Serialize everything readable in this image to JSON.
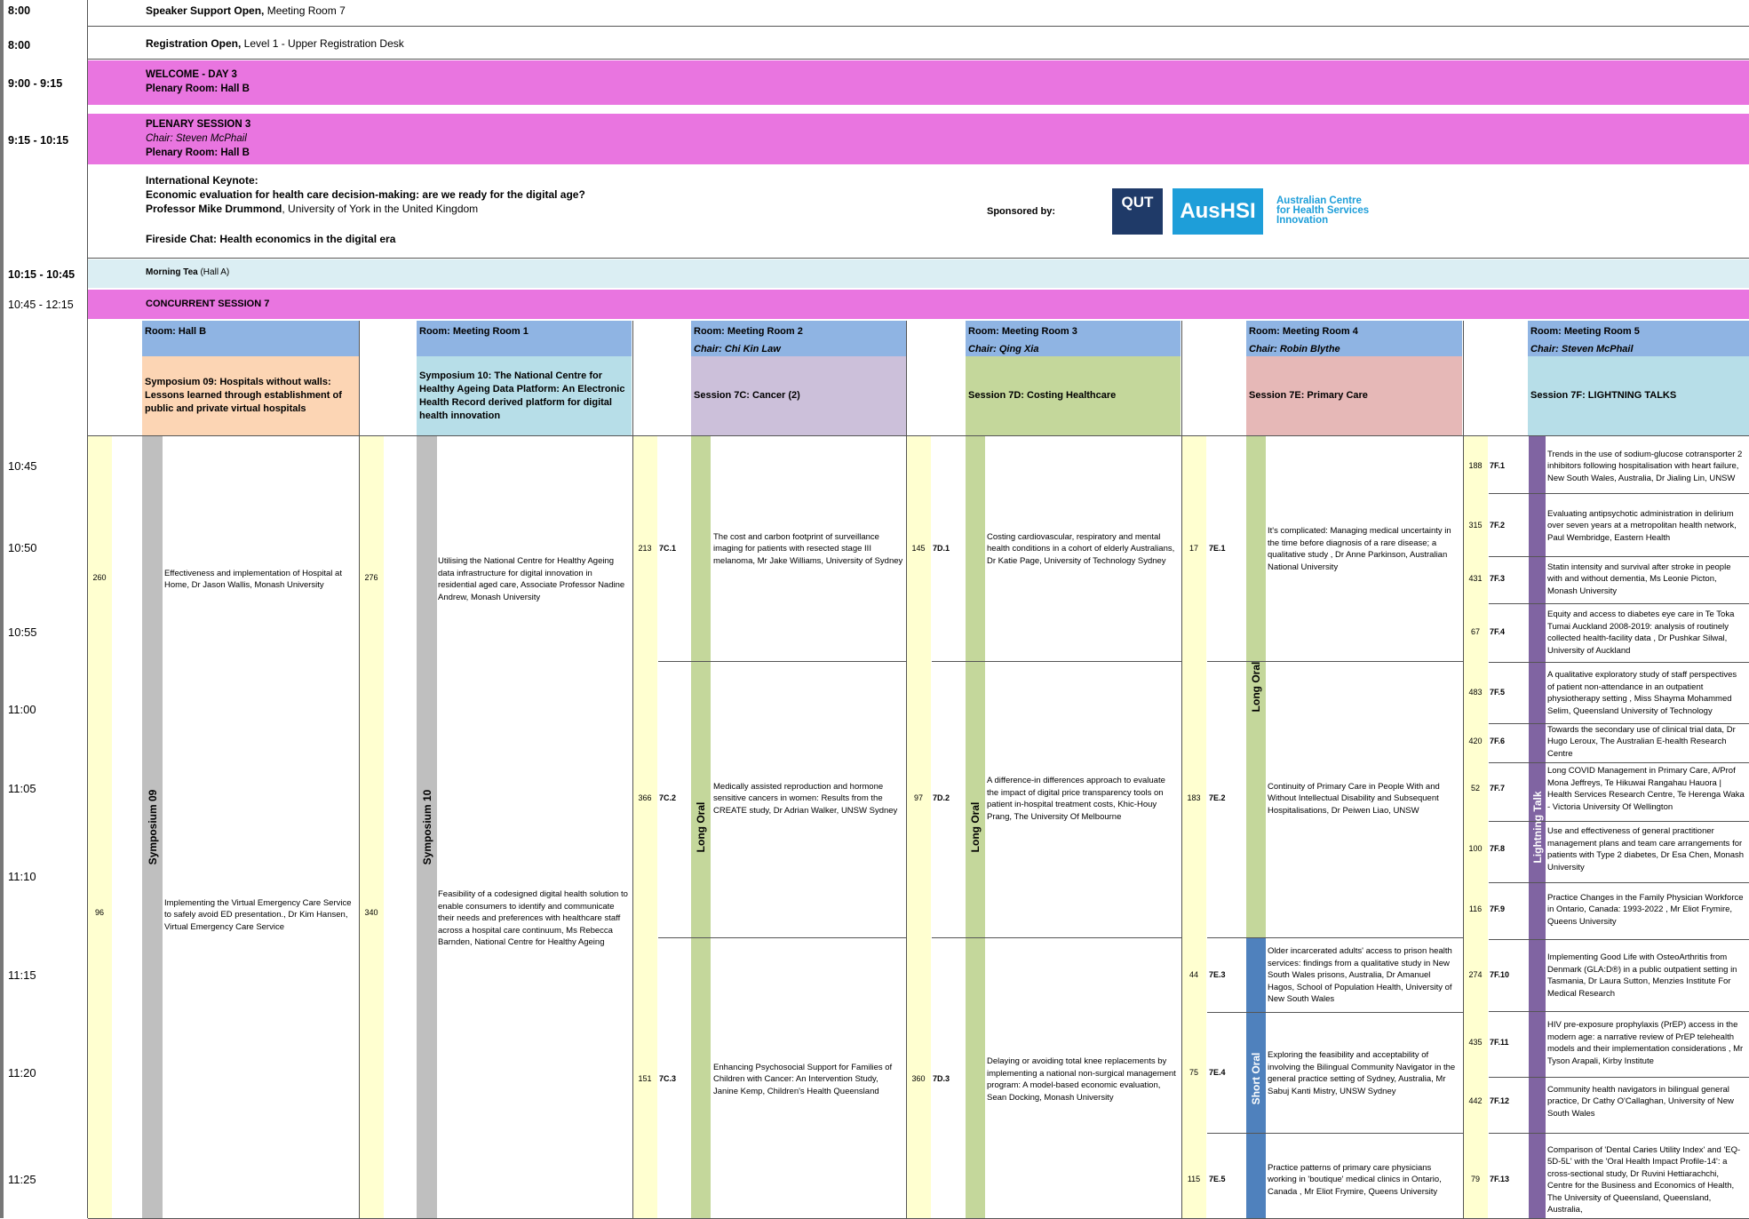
{
  "times": {
    "t0800a": "8:00",
    "t0800b": "8:00",
    "welcome": "9:00 - 9:15",
    "plenary": "9:15 - 10:15",
    "tea": "10:15 - 10:45",
    "concurrent": "10:45 - 12:15",
    "grid": [
      "10:45",
      "10:50",
      "10:55",
      "11:00",
      "11:05",
      "11:10",
      "11:15",
      "11:20",
      "11:25"
    ]
  },
  "speaker_support": {
    "bold": "Speaker Support Open,",
    "rest": " Meeting Room 7"
  },
  "registration": {
    "bold": "Registration Open,",
    "rest": " Level 1 - Upper Registration Desk"
  },
  "welcome": {
    "title": "WELCOME - DAY 3",
    "room": "Plenary Room: Hall B"
  },
  "plenary": {
    "title": "PLENARY SESSION 3",
    "chair": "Chair: Steven McPhail",
    "room": "Plenary Room: Hall B"
  },
  "keynote": {
    "label": "International Keynote:",
    "title": "Economic evaluation for health care decision-making: are we ready for the digital age?",
    "speaker": "Professor Mike Drummond",
    "affiliation": ", University of York in the United Kingdom",
    "fireside": "Fireside Chat: Health economics in the digital era",
    "sponsored": "Sponsored by:",
    "logo_qut": "QUT",
    "logo_aushsi": "AusHSI",
    "logo_text": [
      "Australian Centre",
      "for Health Services",
      "Innovation"
    ]
  },
  "tea": {
    "bold": "Morning Tea",
    "rest": " (Hall A)"
  },
  "concurrent": {
    "title": "CONCURRENT SESSION 7"
  },
  "rooms": [
    {
      "room": "Room: Hall B",
      "chair": "",
      "session": "Symposium 09: Hospitals without walls: Lessons learned through establishment of public and private virtual hospitals",
      "color": "#fcd5b4"
    },
    {
      "room": "Room: Meeting Room 1",
      "chair": "",
      "session": "Symposium 10: The National Centre for Healthy Ageing Data Platform: An Electronic Health Record derived platform for digital health innovation",
      "color": "#b7dee8"
    },
    {
      "room": "Room: Meeting Room 2",
      "chair": "Chair: Chi Kin Law",
      "session": "Session 7C: Cancer (2)",
      "color": "#ccc0da"
    },
    {
      "room": "Room: Meeting Room 3",
      "chair": "Chair: Qing Xia",
      "session": "Session 7D: Costing Healthcare",
      "color": "#c4d79b"
    },
    {
      "room": "Room: Meeting Room 4",
      "chair": "Chair: Robin Blythe",
      "session": "Session 7E: Primary Care",
      "color": "#e6b8b7"
    },
    {
      "room": "Room: Meeting Room 5",
      "chair": "Chair: Steven McPhail",
      "session": "Session 7F: LIGHTNING TALKS",
      "color": "#b7dee8"
    }
  ],
  "col_labels": {
    "sym09": "Symposium 09",
    "sym10": "Symposium 10",
    "c_long": "Long Oral",
    "d_long": "Long Oral",
    "e_long": "Long Oral",
    "e_short": "Short Oral",
    "f_lightning": "Lightning Talk"
  },
  "sym09": [
    {
      "num": "260",
      "text": "Effectiveness and implementation of Hospital at Home, Dr Jason Wallis, Monash University"
    },
    {
      "num": "96",
      "text": "Implementing the Virtual Emergency Care Service to safely avoid ED presentation., Dr Kim Hansen, Virtual Emergency Care Service"
    }
  ],
  "sym10": [
    {
      "num": "276",
      "text": "Utilising the National Centre for Healthy Ageing data infrastructure for digital innovation in residential aged care, Associate Professor Nadine Andrew, Monash University"
    },
    {
      "num": "340",
      "text": "Feasibility of a codesigned digital health solution to enable consumers to identify and communicate their needs and preferences with healthcare staff across a hospital care continuum, Ms Rebecca Barnden, National Centre for Healthy Ageing"
    }
  ],
  "s7c": [
    {
      "num": "213",
      "code": "7C.1",
      "text": "The cost and carbon footprint of surveillance imaging for patients with resected stage III melanoma, Mr Jake Williams, University of Sydney"
    },
    {
      "num": "366",
      "code": "7C.2",
      "text": "Medically assisted reproduction and hormone sensitive cancers in women: Results from the CREATE study, Dr Adrian Walker, UNSW Sydney"
    },
    {
      "num": "151",
      "code": "7C.3",
      "text": "Enhancing Psychosocial Support for Families of Children with Cancer: An Intervention Study, Janine Kemp, Children's Health Queensland"
    }
  ],
  "s7d": [
    {
      "num": "145",
      "code": "7D.1",
      "text": "Costing cardiovascular, respiratory and mental health conditions in a cohort of elderly Australians, Dr Katie Page, University of Technology Sydney"
    },
    {
      "num": "97",
      "code": "7D.2",
      "text": "A difference-in differences approach to evaluate the impact of digital price transparency tools on patient in-hospital treatment costs, Khic-Houy Prang, The University Of Melbourne"
    },
    {
      "num": "360",
      "code": "7D.3",
      "text": "Delaying or avoiding total knee replacements by implementing a national non-surgical management program: A model-based economic evaluation,  Sean Docking, Monash University"
    }
  ],
  "s7e": [
    {
      "num": "17",
      "code": "7E.1",
      "text": "It's complicated: Managing medical uncertainty in the time before diagnosis of a rare disease; a qualitative study , Dr Anne Parkinson, Australian National University"
    },
    {
      "num": "183",
      "code": "7E.2",
      "text": "Continuity of Primary Care in People With and Without Intellectual Disability and Subsequent Hospitalisations, Dr Peiwen Liao, UNSW"
    },
    {
      "num": "44",
      "code": "7E.3",
      "text": "Older incarcerated adults' access to prison health services: findings from a qualitative study in New South Wales prisons, Australia, Dr Amanuel Hagos, School of Population Health, University of New South Wales"
    },
    {
      "num": "75",
      "code": "7E.4",
      "text": "Exploring the feasibility and acceptability of involving the Bilingual Community Navigator in the general practice setting of Sydney, Australia, Mr Sabuj Kanti Mistry, UNSW Sydney"
    },
    {
      "num": "115",
      "code": "7E.5",
      "text": "Practice patterns of primary care physicians working in 'boutique' medical clinics in Ontario, Canada , Mr Eliot Frymire, Queens University"
    }
  ],
  "s7f": [
    {
      "num": "188",
      "code": "7F.1",
      "text": "Trends in the use of sodium-glucose cotransporter 2 inhibitors following hospitalisation with heart failure, New South Wales, Australia, Dr Jialing Lin, UNSW"
    },
    {
      "num": "315",
      "code": "7F.2",
      "text": "Evaluating antipsychotic administration in delirium\nover seven years at a metropolitan health network,  Paul Wembridge, Eastern Health"
    },
    {
      "num": "431",
      "code": "7F.3",
      "text": "Statin intensity and survival after stroke in people with and without dementia, Ms Leonie Picton, Monash University"
    },
    {
      "num": "67",
      "code": "7F.4",
      "text": "Equity and access to diabetes eye care in Te Toka Tumai Auckland 2008-2019: analysis of routinely collected health-facility data , Dr Pushkar Silwal, University of Auckland"
    },
    {
      "num": "483",
      "code": "7F.5",
      "text": "A qualitative exploratory study of staff perspectives of patient non-attendance in an outpatient physiotherapy setting , Miss Shayma Mohammed Selim, Queensland University of Technology"
    },
    {
      "num": "420",
      "code": "7F.6",
      "text": "Towards the secondary use of clinical trial data, Dr Hugo Leroux, The Australian E-health Research Centre"
    },
    {
      "num": "52",
      "code": "7F.7",
      "text": "Long COVID Management in Primary Care, A/Prof Mona Jeffreys, Te Hikuwai Rangahau Hauora | Health Services Research Centre, Te Herenga Waka - Victoria University Of Wellington"
    },
    {
      "num": "100",
      "code": "7F.8",
      "text": "Use and effectiveness of general practitioner management plans and team care arrangements for patients with Type 2 diabetes, Dr Esa Chen, Monash University"
    },
    {
      "num": "116",
      "code": "7F.9",
      "text": "Practice Changes in the Family Physician Workforce in Ontario, Canada: 1993-2022 , Mr Eliot Frymire, Queens University"
    },
    {
      "num": "274",
      "code": "7F.10",
      "text": "Implementing Good Life with OsteoArthritis from Denmark (GLA:D®) in a public outpatient setting in Tasmania, Dr Laura Sutton, Menzies Institute For Medical Research"
    },
    {
      "num": "435",
      "code": "7F.11",
      "text": "HIV pre-exposure prophylaxis (PrEP) access in the modern age: a narrative review of PrEP telehealth models and their implementation considerations , Mr Tyson Arapali, Kirby Institute"
    },
    {
      "num": "442",
      "code": "7F.12",
      "text": "Community health navigators in bilingual general practice, Dr Cathy O'Callaghan, University of New South Wales"
    },
    {
      "num": "79",
      "code": "7F.13",
      "text": "Comparison of 'Dental Caries Utility Index' and 'EQ-5D-5L' with the 'Oral Health Impact Profile-14': a cross-sectional study, Dr Ruvini Hettiarachchi, Centre for the Business and Economics of Health, The University of Queensland, Queensland, Australia,"
    }
  ]
}
